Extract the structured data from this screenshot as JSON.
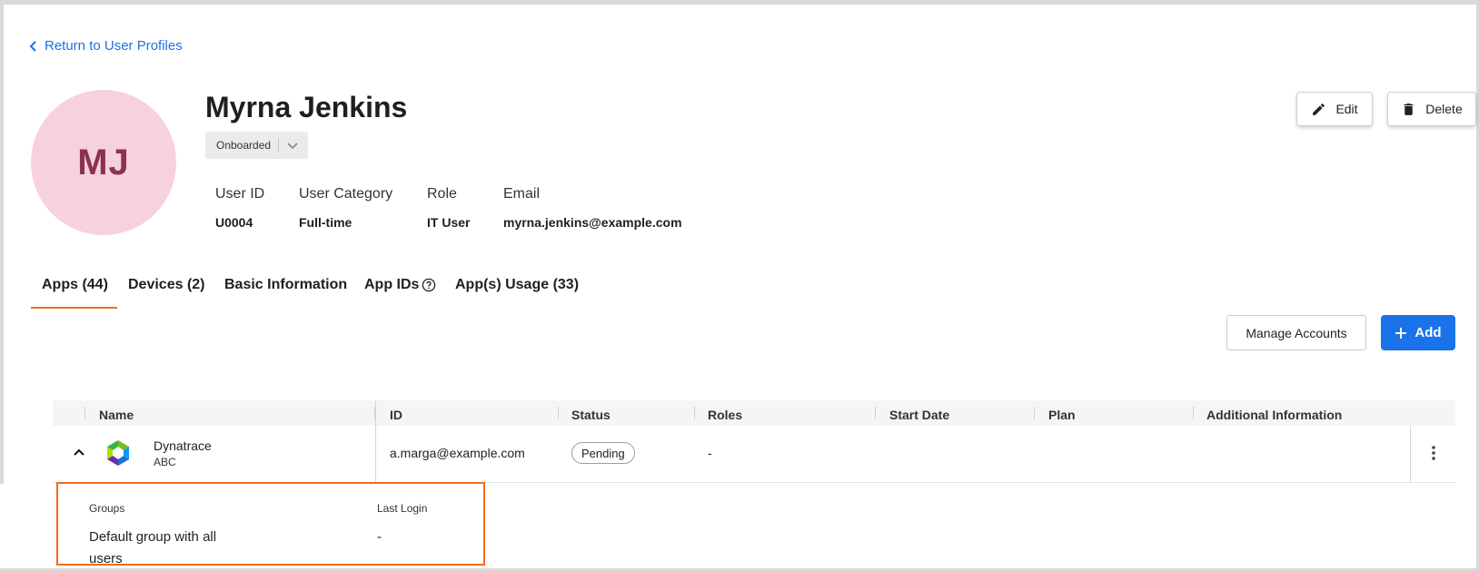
{
  "nav": {
    "back_link": "Return to User Profiles"
  },
  "user": {
    "initials": "MJ",
    "name": "Myrna Jenkins",
    "status": "Onboarded",
    "avatar_color": "#f5d2dd",
    "initials_color": "#8c3250"
  },
  "actions": {
    "edit": "Edit",
    "delete": "Delete"
  },
  "meta": [
    {
      "label": "User ID",
      "value": "U0004"
    },
    {
      "label": "User Category",
      "value": "Full-time"
    },
    {
      "label": "Role",
      "value": "IT User"
    },
    {
      "label": "Email",
      "value": "myrna.jenkins@example.com"
    }
  ],
  "tabs": [
    {
      "label": "Apps (44)",
      "active": true
    },
    {
      "label": "Devices (2)"
    },
    {
      "label": "Basic Information"
    },
    {
      "label": "App IDs",
      "icon": "help-circle-icon"
    },
    {
      "label": "App(s) Usage (33)"
    }
  ],
  "toolbar": {
    "manage_accounts": "Manage Accounts",
    "add": "Add"
  },
  "table": {
    "columns": [
      "Name",
      "ID",
      "Status",
      "Roles",
      "Start Date",
      "Plan",
      "Additional Information"
    ],
    "rows": [
      {
        "app_name": "Dynatrace",
        "app_sub": "ABC",
        "id": "a.marga@example.com",
        "status": "Pending",
        "roles": "-",
        "start_date": "",
        "plan": "",
        "additional_information": ""
      }
    ]
  },
  "details": {
    "groups_label": "Groups",
    "groups_value": "Default group with all users",
    "last_login_label": "Last Login",
    "last_login_value": "-"
  },
  "colors": {
    "accent": "#1a73e8",
    "tab_underline": "#f26b1d",
    "highlight_border": "#f26b1d"
  }
}
